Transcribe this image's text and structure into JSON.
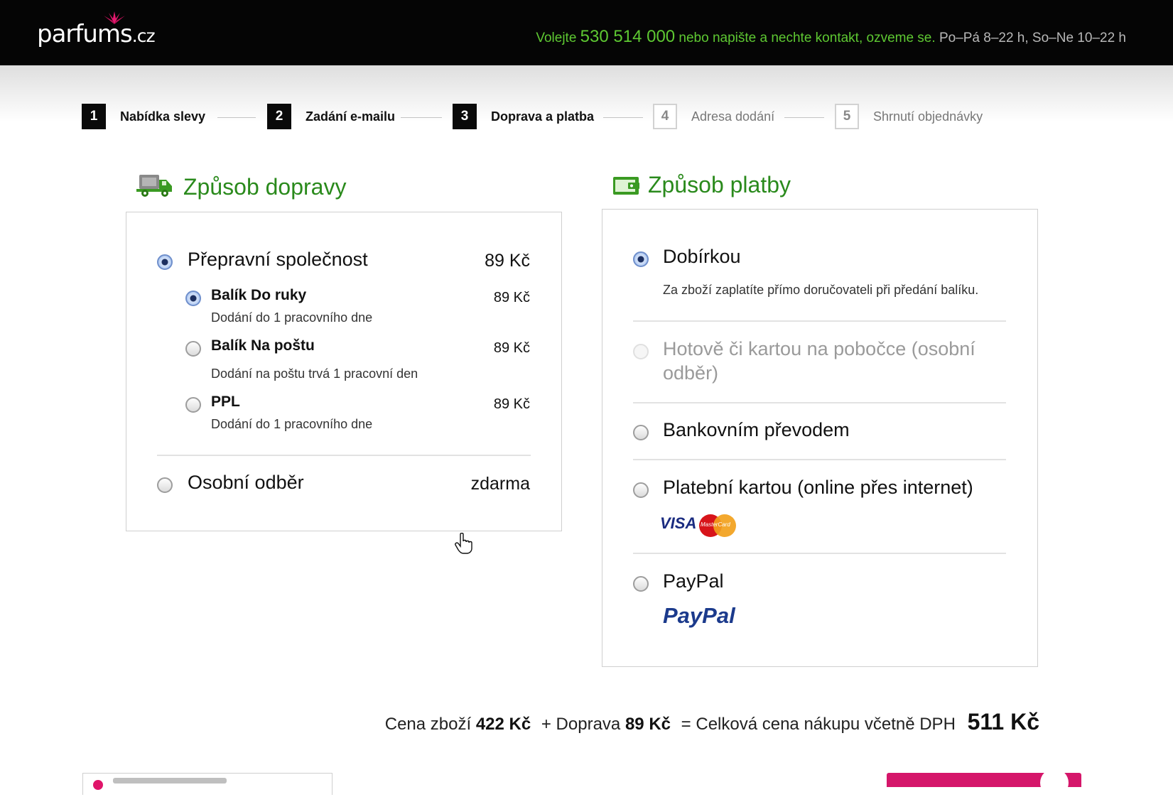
{
  "header": {
    "logo_main": "parfums",
    "logo_tld": ".cz",
    "contact_prefix": "Volejte",
    "phone": "530 514 000",
    "contact_middle": "nebo napište a nechte kontakt, ozveme se.",
    "hours": "Po–Pá 8–22 h, So–Ne 10–22 h"
  },
  "steps": [
    {
      "num": "1",
      "label": "Nabídka slevy"
    },
    {
      "num": "2",
      "label": "Zadání e-mailu"
    },
    {
      "num": "3",
      "label": "Doprava a platba"
    },
    {
      "num": "4",
      "label": "Adresa dodání"
    },
    {
      "num": "5",
      "label": "Shrnutí objednávky"
    }
  ],
  "shipping": {
    "title": "Způsob dopravy",
    "carrier": {
      "label": "Přepravní společnost",
      "price": "89 Kč"
    },
    "options": [
      {
        "label": "Balík Do ruky",
        "desc": "Dodání do 1 pracovního dne",
        "price": "89 Kč"
      },
      {
        "label": "Balík Na poštu",
        "desc": "Dodání na poštu trvá 1 pracovní den",
        "price": "89 Kč"
      },
      {
        "label": "PPL",
        "desc": "Dodání do 1 pracovního dne",
        "price": "89 Kč"
      }
    ],
    "pickup": {
      "label": "Osobní odběr",
      "price": "zdarma"
    }
  },
  "payment": {
    "title": "Způsob platby",
    "options": [
      {
        "label": "Dobírkou",
        "desc": "Za zboží zaplatíte přímo doručovateli při předání balíku."
      },
      {
        "label": "Hotově či kartou na pobočce (osobní odběr)"
      },
      {
        "label": "Bankovním převodem"
      },
      {
        "label": "Platební kartou (online přes internet)",
        "card_logo_visa": "VISA",
        "card_logo_mc": "MasterCard"
      },
      {
        "label": "PayPal",
        "logo": "PayPal"
      }
    ]
  },
  "summary": {
    "goods_label": "Cena zboží",
    "goods_price": "422 Kč",
    "shipping_label": "+ Doprava",
    "shipping_price": "89 Kč",
    "total_label": "= Celková cena nákupu včetně DPH",
    "total_price": "511 Kč"
  },
  "icons": {
    "truck": "truck-icon",
    "wallet": "wallet-icon"
  },
  "colors": {
    "header_bg": "#050505",
    "accent_green": "#2a8a1c",
    "contact_green": "#5ec832",
    "brand_pink": "#d5166a"
  }
}
